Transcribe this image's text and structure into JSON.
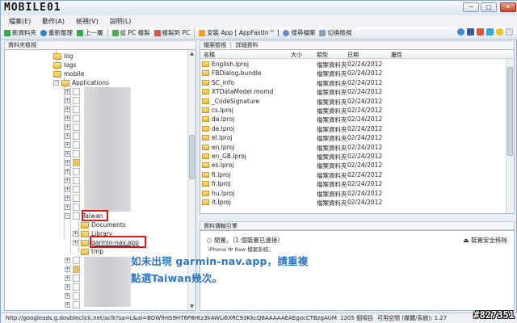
{
  "title": {
    "logo_text": "MOBILE01",
    "min": "─",
    "max": "□",
    "close": "✕"
  },
  "menu": [
    "檔案(E)",
    "動作(A)",
    "檢視(V)",
    "說明(L)"
  ],
  "toolbar": {
    "new_folder": "新資料夾",
    "refresh": "重新整理",
    "up": "上一層",
    "copy_to_pc": "從 PC 複製",
    "copy_from_pc": "複製到 PC",
    "install_app": "安裝 App [ AppFastIn™ ]",
    "search": "搜尋檔案",
    "switch_view": "切換檢視"
  },
  "left_pane": {
    "header": "資料夾檢視",
    "nodes": {
      "log": "log",
      "logs": "logs",
      "mobile": "mobile",
      "applications": "Applications",
      "taiwan": "Taiwan",
      "documents": "Documents",
      "library": "Library",
      "garmin": "garmin-nav.app",
      "tmp": "tmp"
    }
  },
  "right_pane": {
    "tabs": "檔案檢視 ｜ 詳細資料",
    "columns": {
      "name": "名稱",
      "size": "大小",
      "type": "類型",
      "date": "日期",
      "attr": "屬性"
    },
    "files": [
      {
        "name": "English.lproj",
        "type": "檔案資料夾",
        "date": "02/24/2012"
      },
      {
        "name": "FBDialog.bundle",
        "type": "檔案資料夾",
        "date": "02/24/2012"
      },
      {
        "name": "SC_Info",
        "type": "檔案資料夾",
        "date": "02/24/2012"
      },
      {
        "name": "XTDataModel.momd",
        "type": "檔案資料夾",
        "date": "02/24/2012"
      },
      {
        "name": "_CodeSignature",
        "type": "檔案資料夾",
        "date": "02/24/2012"
      },
      {
        "name": "cs.lproj",
        "type": "檔案資料夾",
        "date": "02/24/2012"
      },
      {
        "name": "da.lproj",
        "type": "檔案資料夾",
        "date": "02/24/2012"
      },
      {
        "name": "de.lproj",
        "type": "檔案資料夾",
        "date": "02/24/2012"
      },
      {
        "name": "el.lproj",
        "type": "檔案資料夾",
        "date": "02/24/2012"
      },
      {
        "name": "en.lproj",
        "type": "檔案資料夾",
        "date": "02/24/2012"
      },
      {
        "name": "en_GB.lproj",
        "type": "檔案資料夾",
        "date": "02/24/2012"
      },
      {
        "name": "es.lproj",
        "type": "檔案資料夾",
        "date": "02/24/2012"
      },
      {
        "name": "fi.lproj",
        "type": "檔案資料夾",
        "date": "02/24/2012"
      },
      {
        "name": "fr.lproj",
        "type": "檔案資料夾",
        "date": "02/24/2012"
      },
      {
        "name": "hu.lproj",
        "type": "檔案資料夾",
        "date": "02/24/2012"
      },
      {
        "name": "it.lproj",
        "type": "檔案資料夾",
        "date": "02/24/2012"
      }
    ]
  },
  "transfer": {
    "header": "資料傳輸引擎",
    "idle": "閒置。（1 個裝置已連接）",
    "mode": "iPhone 中 Raw 檔案系統。",
    "safe_remove": "裝置安全移除"
  },
  "annotation": {
    "line1": "如未出現 garmin-nav.app，請重複",
    "line2": "點選Taiwan幾次。"
  },
  "status": {
    "url": "http://googleads.g.doubleclick.net/aclk?sa=L&ai=BDWfHIS9HT6P8Htz3kAWLi6XRC93KkcQ8AAAAAEAEgocCTBzgAUMHIwMf6",
    "count": "1205 個項目",
    "space": "可用空間 (媒體/系統): 1.27"
  },
  "watermark": "#827351"
}
